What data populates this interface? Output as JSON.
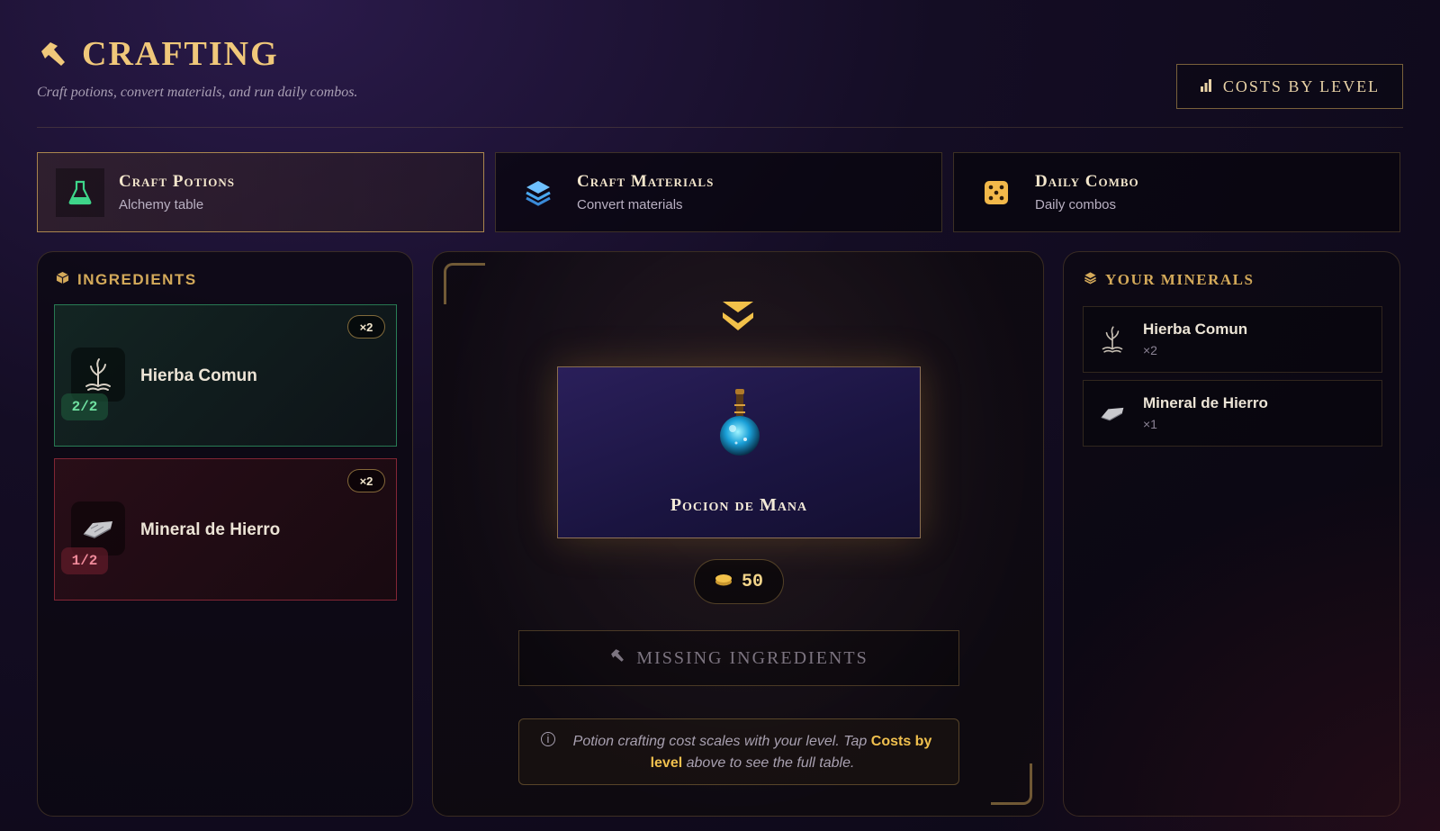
{
  "header": {
    "title": "CRAFTING",
    "subtitle": "Craft potions, convert materials, and run daily combos.",
    "costs_button": "COSTS BY LEVEL"
  },
  "tabs": [
    {
      "title": "Craft Potions",
      "subtitle": "Alchemy table",
      "icon": "flask-icon",
      "color": "#3ed68a"
    },
    {
      "title": "Craft Materials",
      "subtitle": "Convert materials",
      "icon": "layers-icon",
      "color": "#4aa8f0"
    },
    {
      "title": "Daily Combo",
      "subtitle": "Daily combos",
      "icon": "dice-icon",
      "color": "#f2b84a"
    }
  ],
  "ingredients": {
    "heading": "INGREDIENTS",
    "items": [
      {
        "name": "Hierba Comun",
        "multiplier": "×2",
        "progress": "2/2",
        "icon": "herb-icon",
        "status": "ok"
      },
      {
        "name": "Mineral de Hierro",
        "multiplier": "×2",
        "progress": "1/2",
        "icon": "ingot-icon",
        "status": "missing"
      }
    ]
  },
  "craft": {
    "result_name": "Pocion de Mana",
    "cost": "50",
    "action_label": "MISSING INGREDIENTS",
    "note_part1": "Potion crafting cost scales with your level. Tap ",
    "note_link": "Costs by level",
    "note_part2": " above to see the full table."
  },
  "minerals": {
    "heading": "YOUR MINERALS",
    "items": [
      {
        "name": "Hierba Comun",
        "qty": "×2",
        "icon": "herb-icon"
      },
      {
        "name": "Mineral de Hierro",
        "qty": "×1",
        "icon": "ingot-icon"
      }
    ]
  },
  "colors": {
    "gold": "#d4aa5a",
    "ok": "#3ed68a",
    "missing": "#e0506a"
  }
}
